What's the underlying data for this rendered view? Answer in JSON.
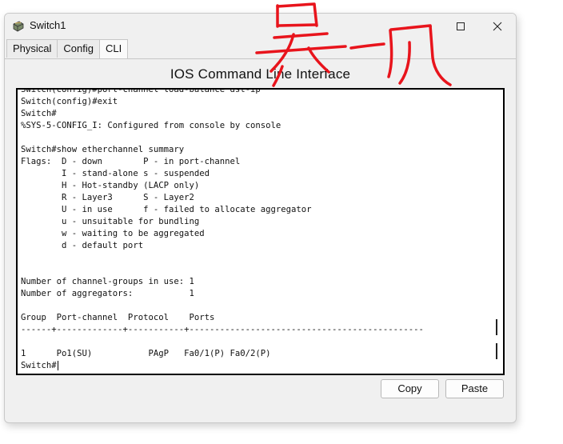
{
  "window": {
    "title": "Switch1",
    "icon": "switch-app-icon",
    "controls": [
      "minimize-icon",
      "maximize-icon",
      "close-icon"
    ]
  },
  "tabs": [
    {
      "label": "Physical",
      "active": false
    },
    {
      "label": "Config",
      "active": false
    },
    {
      "label": "CLI",
      "active": true
    }
  ],
  "panel": {
    "heading": "IOS Command Line Interface"
  },
  "terminal": {
    "lines": [
      "Switch(config)#port-channel load-balance dst-ip",
      "Switch(config)#exit",
      "Switch#",
      "%SYS-5-CONFIG_I: Configured from console by console",
      "",
      "Switch#show etherchannel summary",
      "Flags:  D - down        P - in port-channel",
      "        I - stand-alone s - suspended",
      "        H - Hot-standby (LACP only)",
      "        R - Layer3      S - Layer2",
      "        U - in use      f - failed to allocate aggregator",
      "        u - unsuitable for bundling",
      "        w - waiting to be aggregated",
      "        d - default port",
      "",
      "",
      "Number of channel-groups in use: 1",
      "Number of aggregators:           1",
      "",
      "Group  Port-channel  Protocol    Ports",
      "------+-------------+-----------+----------------------------------------------",
      "",
      "1      Po1(SU)           PAgP   Fa0/1(P) Fa0/2(P)"
    ],
    "prompt": "Switch#"
  },
  "buttons": {
    "copy": "Copy",
    "paste": "Paste"
  },
  "colors": {
    "window_bg": "#f0f0f0",
    "terminal_bg": "#ffffff",
    "annotation": "#e8141c"
  }
}
